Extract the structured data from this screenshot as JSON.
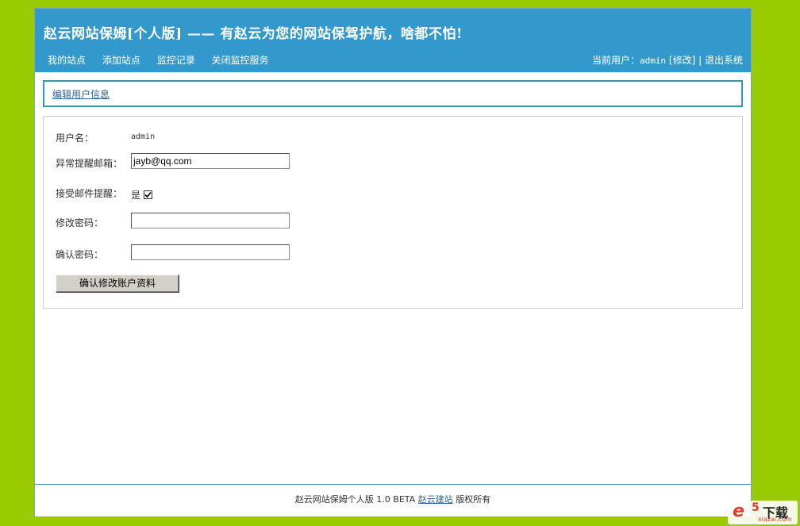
{
  "header": {
    "title": "赵云网站保姆[个人版] —— 有赵云为您的网站保驾护航，啥都不怕!",
    "nav": [
      "我的站点",
      "添加站点",
      "监控记录",
      "关闭监控服务"
    ],
    "user_prefix": "当前用户：",
    "username": "admin",
    "edit_link": "[修改]",
    "separator": "|",
    "logout": "退出系统"
  },
  "breadcrumb": {
    "label": "编辑用户信息"
  },
  "form": {
    "username_label": "用户名：",
    "username_value": "admin",
    "email_label": "异常提醒邮箱：",
    "email_value": "jayb@qq.com",
    "receive_label": "接受邮件提醒：",
    "receive_option": "是",
    "receive_checked": true,
    "password_label": "修改密码：",
    "confirm_label": "确认密码：",
    "submit_label": "确认修改账户资料"
  },
  "footer": {
    "text": "赵云网站保姆个人版 1.0 BETA",
    "link": "赵云建站",
    "suffix": "版权所有"
  },
  "watermark": {
    "brand": "e",
    "number": "5",
    "text": "下载",
    "url": "xiazai.com"
  },
  "colors": {
    "page_bg": "#99cc00",
    "header_bg": "#3399cc",
    "link": "#336699"
  }
}
